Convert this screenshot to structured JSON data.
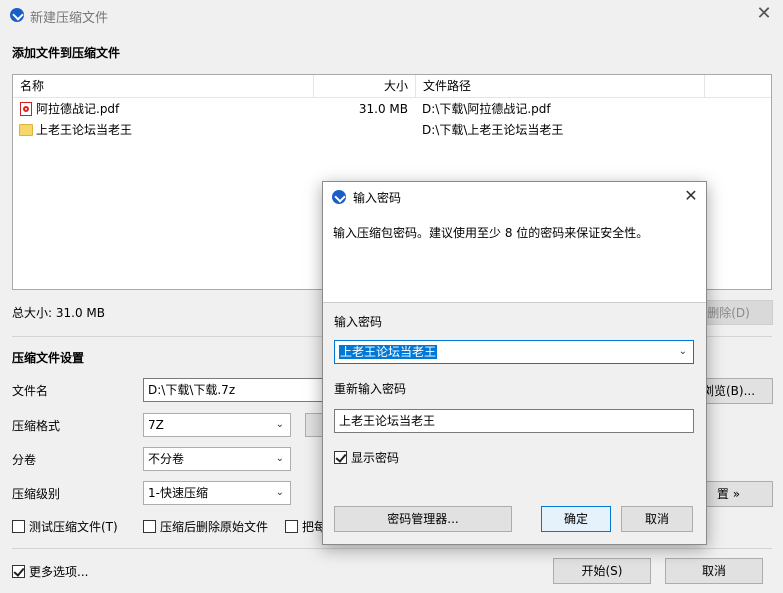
{
  "window": {
    "title": "新建压缩文件",
    "close_symbol": "✕"
  },
  "files_section": {
    "heading": "添加文件到压缩文件",
    "columns": {
      "name": "名称",
      "size": "大小",
      "path": "文件路径"
    },
    "rows": [
      {
        "name": "阿拉德战记.pdf",
        "size": "31.0 MB",
        "path": "D:\\下载\\阿拉德战记.pdf",
        "icon": "pdf-icon"
      },
      {
        "name": "上老王论坛当老王",
        "size": "",
        "path": "D:\\下载\\上老王论坛当老王",
        "icon": "folder-icon"
      }
    ],
    "total_size": "总大小: 31.0 MB",
    "delete_button": "删除(D)"
  },
  "settings": {
    "heading": "压缩文件设置",
    "filename_label": "文件名",
    "filename_value": "D:\\下载\\下载.7z",
    "browse_button": "浏览(B)...",
    "format_label": "压缩格式",
    "format_value": "7Z",
    "split_label": "分卷",
    "split_value": "不分卷",
    "level_label": "压缩级别",
    "level_value": "1-快速压缩",
    "advanced_button": "置 »",
    "test_label": "测试压缩文件(T)",
    "delete_after_label": "压缩后删除原始文件",
    "each_label": "把每"
  },
  "footer": {
    "more_options_label": "更多选项...",
    "start_button": "开始(S)",
    "cancel_button": "取消"
  },
  "dialog": {
    "title": "输入密码",
    "hint": "输入压缩包密码。建议使用至少 8 位的密码来保证安全性。",
    "password_label": "输入密码",
    "password_value": "上老王论坛当老王",
    "repeat_label": "重新输入密码",
    "repeat_value": "上老王论坛当老王",
    "show_password_label": "显示密码",
    "manager_button": "密码管理器...",
    "ok_button": "确定",
    "cancel_button": "取消",
    "close_symbol": "✕"
  },
  "colors": {
    "accent": "#0078d7",
    "app_icon": "#1a5fc8",
    "folder": "#f7d76a",
    "pdf": "#cc2222"
  }
}
